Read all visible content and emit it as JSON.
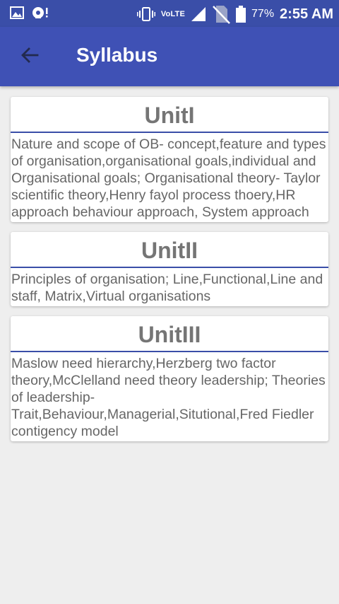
{
  "status_bar": {
    "network_label": "VoLTE",
    "battery_percent": "77%",
    "time": "2:55 AM"
  },
  "app_bar": {
    "title": "Syllabus"
  },
  "units": [
    {
      "title": "UnitI",
      "body": "Nature and scope of OB- concept,feature and types of organisation,organisational goals,individual and Organisational goals; Organisational theory- Taylor scientific theory,Henry fayol process thoery,HR approach behaviour approach, System approach"
    },
    {
      "title": "UnitII",
      "body": "Principles of organisation; Line,Functional,Line and staff, Matrix,Virtual organisations"
    },
    {
      "title": "UnitIII",
      "body": "Maslow need hierarchy,Herzberg two factor theory,McClelland need theory leadership; Theories of leadership- Trait,Behaviour,Managerial,Situtional,Fred Fiedler contigency model"
    }
  ],
  "colors": {
    "status_bar": "#3a4ea8",
    "app_bar": "#3f51b5",
    "background": "#eeeeee",
    "title_text": "#757575",
    "divider": "#3a4ea8"
  }
}
